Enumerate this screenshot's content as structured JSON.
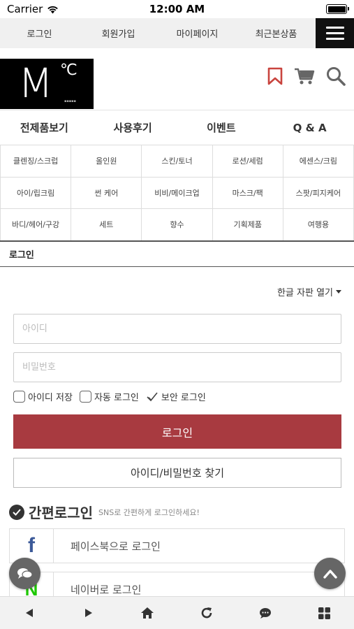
{
  "status_bar": {
    "carrier": "Carrier",
    "time": "12:00 AM"
  },
  "top_nav": {
    "links": [
      "로그인",
      "회원가입",
      "마이페이지",
      "최근본상품"
    ]
  },
  "logo": {
    "letter": "M",
    "degree": "℃"
  },
  "colors": {
    "accent": "#a83a40",
    "facebook": "#3b5998",
    "naver": "#1ec800"
  },
  "main_nav": [
    "전제품보기",
    "사용후기",
    "이벤트",
    "Q & A"
  ],
  "sub_categories": [
    "클렌징/스크럽",
    "올인원",
    "스킨/토너",
    "로션/세럼",
    "에센스/크림",
    "아이/립크림",
    "썬 케어",
    "비비/메이크업",
    "마스크/팩",
    "스팟/피지케어",
    "바디/헤어/구강",
    "세트",
    "향수",
    "기획제품",
    "여행용"
  ],
  "page_title": "로그인",
  "keyboard_toggle": "한글 자판 열기",
  "login_form": {
    "id_placeholder": "아이디",
    "pw_placeholder": "비밀번호",
    "save_id_label": "아이디 저장",
    "auto_login_label": "자동 로그인",
    "secure_login_label": "보안 로그인",
    "login_button": "로그인",
    "find_button": "아이디/비밀번호 찾기"
  },
  "sns": {
    "title": "간편로그인",
    "subtitle": "SNS로 간편하게 로그인하세요!",
    "facebook_letter": "f",
    "facebook_label": "페이스북으로 로그인",
    "naver_letter": "N",
    "naver_label": "네이버로 로그인"
  }
}
